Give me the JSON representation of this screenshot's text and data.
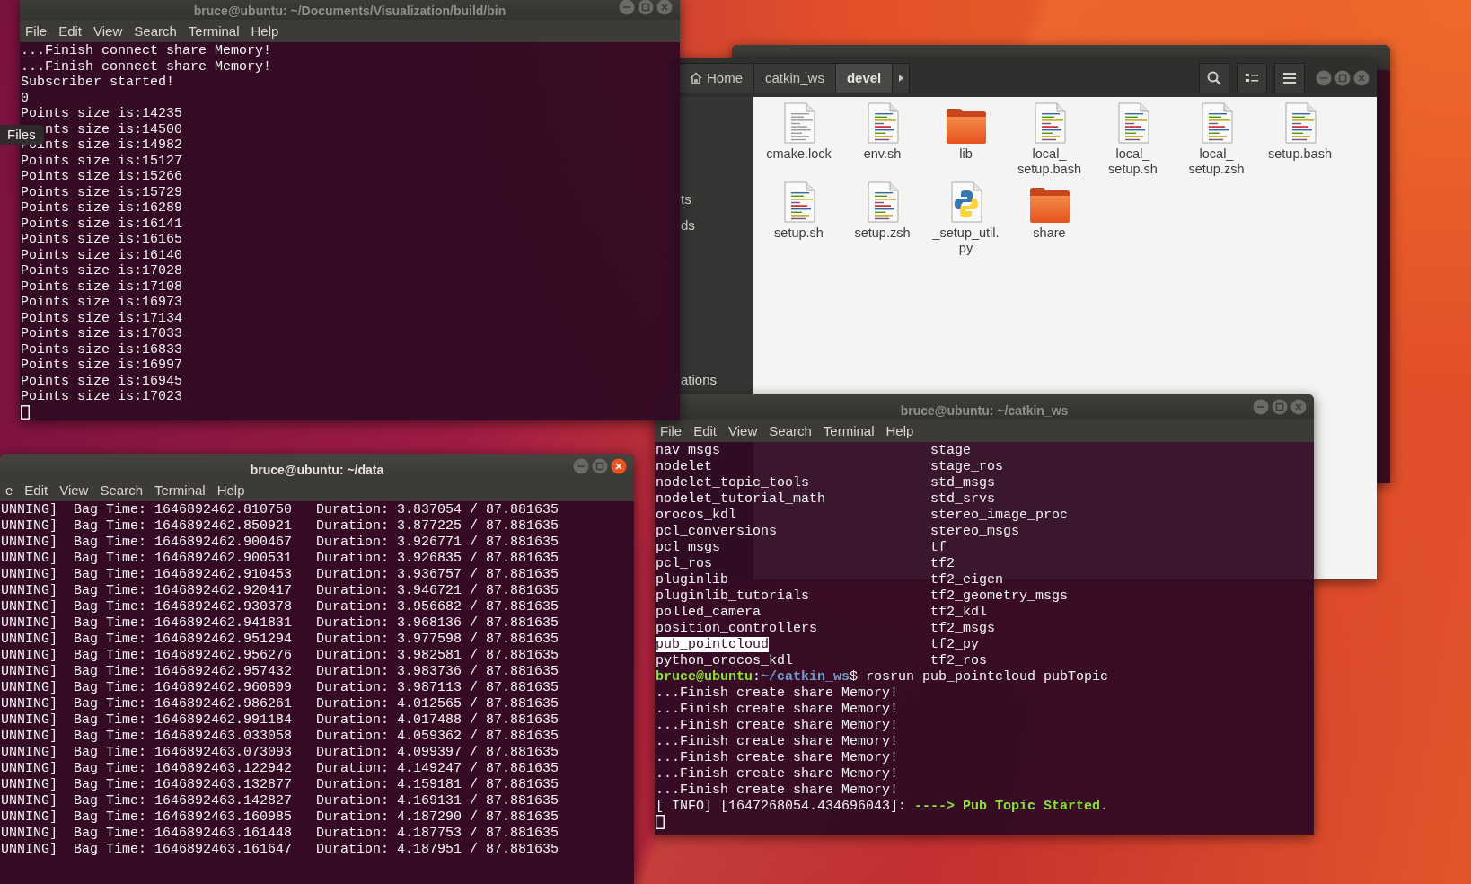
{
  "desktop": {
    "tooltip": "Files"
  },
  "windows": [
    {
      "kind": "terminal",
      "active": false
    },
    {
      "kind": "files",
      "path": [
        {
          "label": "Home",
          "kind": "home",
          "selected": false
        },
        {
          "label": "catkin_ws",
          "kind": "folder",
          "selected": false
        },
        {
          "label": "devel",
          "kind": "folder",
          "selected": true
        }
      ],
      "sidebar": [
        "ts",
        "ds",
        "ations"
      ],
      "items": [
        {
          "label": "cmake.lock",
          "kind": "text"
        },
        {
          "label": "env.sh",
          "kind": "script"
        },
        {
          "label": "lib",
          "kind": "folder"
        },
        {
          "label": "local_\nsetup.bash",
          "kind": "script"
        },
        {
          "label": "local_\nsetup.sh",
          "kind": "script"
        },
        {
          "label": "local_\nsetup.zsh",
          "kind": "script"
        },
        {
          "label": "setup.bash",
          "kind": "script"
        },
        {
          "label": "setup.sh",
          "kind": "script"
        },
        {
          "label": "setup.zsh",
          "kind": "script"
        },
        {
          "label": "_setup_util.\npy",
          "kind": "python"
        },
        {
          "label": "share",
          "kind": "folder"
        }
      ]
    },
    {
      "kind": "terminal",
      "title": "bruce@ubuntu: ~/catkin_ws",
      "active": false,
      "menu": [
        "File",
        "Edit",
        "View",
        "Search",
        "Terminal",
        "Help"
      ],
      "cursor": true,
      "lines": [
        {
          "kind": "columns",
          "cells": [
            "nav_msgs",
            "stage"
          ],
          "selected": false
        },
        {
          "kind": "columns",
          "cells": [
            "nodelet",
            "stage_ros"
          ],
          "selected": false
        },
        {
          "kind": "columns",
          "cells": [
            "nodelet_topic_tools",
            "std_msgs"
          ],
          "selected": false
        },
        {
          "kind": "columns",
          "cells": [
            "nodelet_tutorial_math",
            "std_srvs"
          ],
          "selected": false
        },
        {
          "kind": "columns",
          "cells": [
            "orocos_kdl",
            "stereo_image_proc"
          ],
          "selected": false
        },
        {
          "kind": "columns",
          "cells": [
            "pcl_conversions",
            "stereo_msgs"
          ],
          "selected": false
        },
        {
          "kind": "columns",
          "cells": [
            "pcl_msgs",
            "tf"
          ],
          "selected": false
        },
        {
          "kind": "columns",
          "cells": [
            "pcl_ros",
            "tf2"
          ],
          "selected": false
        },
        {
          "kind": "columns",
          "cells": [
            "pluginlib",
            "tf2_eigen"
          ],
          "selected": false
        },
        {
          "kind": "columns",
          "cells": [
            "pluginlib_tutorials",
            "tf2_geometry_msgs"
          ],
          "selected": false
        },
        {
          "kind": "columns",
          "cells": [
            "polled_camera",
            "tf2_kdl"
          ],
          "selected": false
        },
        {
          "kind": "columns",
          "cells": [
            "position_controllers",
            "tf2_msgs"
          ],
          "selected": false
        },
        {
          "kind": "columns",
          "cells": [
            "pub_pointcloud",
            "tf2_py"
          ],
          "selected": true
        },
        {
          "kind": "columns",
          "cells": [
            "python_orocos_kdl",
            "tf2_ros"
          ],
          "selected": false
        },
        {
          "kind": "segments",
          "segments": [
            {
              "text": "bruce@ubuntu",
              "kind": "user"
            },
            {
              "text": ":",
              "kind": "plain"
            },
            {
              "text": "~/catkin_ws",
              "kind": "path"
            },
            {
              "text": "$ rosrun pub_pointcloud pubTopic",
              "kind": "plain"
            }
          ]
        },
        {
          "kind": "text",
          "text": "...Finish create share Memory!"
        },
        {
          "kind": "text",
          "text": "...Finish create share Memory!"
        },
        {
          "kind": "text",
          "text": "...Finish create share Memory!"
        },
        {
          "kind": "text",
          "text": "...Finish create share Memory!"
        },
        {
          "kind": "text",
          "text": "...Finish create share Memory!"
        },
        {
          "kind": "text",
          "text": "...Finish create share Memory!"
        },
        {
          "kind": "text",
          "text": "...Finish create share Memory!"
        },
        {
          "kind": "segments",
          "segments": [
            {
              "text": "[ INFO] [1647268054.434696043]: ",
              "kind": "plain"
            },
            {
              "text": "----> Pub Topic Started.",
              "kind": "success"
            }
          ]
        }
      ]
    },
    {
      "kind": "terminal",
      "title": "bruce@ubuntu: ~/Documents/Visualization/build/bin",
      "active": false,
      "menu": [
        "File",
        "Edit",
        "View",
        "Search",
        "Terminal",
        "Help"
      ],
      "cursor": true,
      "lines": [
        {
          "kind": "text",
          "text": "...Finish connect share Memory!"
        },
        {
          "kind": "text",
          "text": "...Finish connect share Memory!"
        },
        {
          "kind": "text",
          "text": "Subscriber started!"
        },
        {
          "kind": "text",
          "text": "0"
        },
        {
          "kind": "text",
          "text": "Points size is:14235"
        },
        {
          "kind": "covered",
          "text": "nts size is:14500"
        },
        {
          "kind": "text",
          "text": "Points size is:14982"
        },
        {
          "kind": "text",
          "text": "Points size is:15127"
        },
        {
          "kind": "text",
          "text": "Points size is:15266"
        },
        {
          "kind": "text",
          "text": "Points size is:15729"
        },
        {
          "kind": "text",
          "text": "Points size is:16289"
        },
        {
          "kind": "text",
          "text": "Points size is:16141"
        },
        {
          "kind": "text",
          "text": "Points size is:16165"
        },
        {
          "kind": "text",
          "text": "Points size is:16140"
        },
        {
          "kind": "text",
          "text": "Points size is:17028"
        },
        {
          "kind": "text",
          "text": "Points size is:17108"
        },
        {
          "kind": "text",
          "text": "Points size is:16973"
        },
        {
          "kind": "text",
          "text": "Points size is:17134"
        },
        {
          "kind": "text",
          "text": "Points size is:17033"
        },
        {
          "kind": "text",
          "text": "Points size is:16833"
        },
        {
          "kind": "text",
          "text": "Points size is:16997"
        },
        {
          "kind": "text",
          "text": "Points size is:16945"
        },
        {
          "kind": "text",
          "text": "Points size is:17023"
        }
      ]
    },
    {
      "kind": "terminal",
      "title": "bruce@ubuntu: ~/data",
      "active": true,
      "menu": [
        "e",
        "Edit",
        "View",
        "Search",
        "Terminal",
        "Help"
      ],
      "lines": [
        {
          "kind": "text",
          "text": "UNNING]  Bag Time: 1646892462.810750   Duration: 3.837054 / 87.881635"
        },
        {
          "kind": "text",
          "text": "UNNING]  Bag Time: 1646892462.850921   Duration: 3.877225 / 87.881635"
        },
        {
          "kind": "text",
          "text": "UNNING]  Bag Time: 1646892462.900467   Duration: 3.926771 / 87.881635"
        },
        {
          "kind": "text",
          "text": "UNNING]  Bag Time: 1646892462.900531   Duration: 3.926835 / 87.881635"
        },
        {
          "kind": "text",
          "text": "UNNING]  Bag Time: 1646892462.910453   Duration: 3.936757 / 87.881635"
        },
        {
          "kind": "text",
          "text": "UNNING]  Bag Time: 1646892462.920417   Duration: 3.946721 / 87.881635"
        },
        {
          "kind": "text",
          "text": "UNNING]  Bag Time: 1646892462.930378   Duration: 3.956682 / 87.881635"
        },
        {
          "kind": "text",
          "text": "UNNING]  Bag Time: 1646892462.941831   Duration: 3.968136 / 87.881635"
        },
        {
          "kind": "text",
          "text": "UNNING]  Bag Time: 1646892462.951294   Duration: 3.977598 / 87.881635"
        },
        {
          "kind": "text",
          "text": "UNNING]  Bag Time: 1646892462.956276   Duration: 3.982581 / 87.881635"
        },
        {
          "kind": "text",
          "text": "UNNING]  Bag Time: 1646892462.957432   Duration: 3.983736 / 87.881635"
        },
        {
          "kind": "text",
          "text": "UNNING]  Bag Time: 1646892462.960809   Duration: 3.987113 / 87.881635"
        },
        {
          "kind": "text",
          "text": "UNNING]  Bag Time: 1646892462.986261   Duration: 4.012565 / 87.881635"
        },
        {
          "kind": "text",
          "text": "UNNING]  Bag Time: 1646892462.991184   Duration: 4.017488 / 87.881635"
        },
        {
          "kind": "text",
          "text": "UNNING]  Bag Time: 1646892463.033058   Duration: 4.059362 / 87.881635"
        },
        {
          "kind": "text",
          "text": "UNNING]  Bag Time: 1646892463.073093   Duration: 4.099397 / 87.881635"
        },
        {
          "kind": "text",
          "text": "UNNING]  Bag Time: 1646892463.122942   Duration: 4.149247 / 87.881635"
        },
        {
          "kind": "text",
          "text": "UNNING]  Bag Time: 1646892463.132877   Duration: 4.159181 / 87.881635"
        },
        {
          "kind": "text",
          "text": "UNNING]  Bag Time: 1646892463.142827   Duration: 4.169131 / 87.881635"
        },
        {
          "kind": "text",
          "text": "UNNING]  Bag Time: 1646892463.160985   Duration: 4.187290 / 87.881635"
        },
        {
          "kind": "text",
          "text": "UNNING]  Bag Time: 1646892463.161448   Duration: 4.187753 / 87.881635"
        },
        {
          "kind": "text",
          "text": "UNNING]  Bag Time: 1646892463.161647   Duration: 4.187951 / 87.881635"
        }
      ]
    }
  ]
}
